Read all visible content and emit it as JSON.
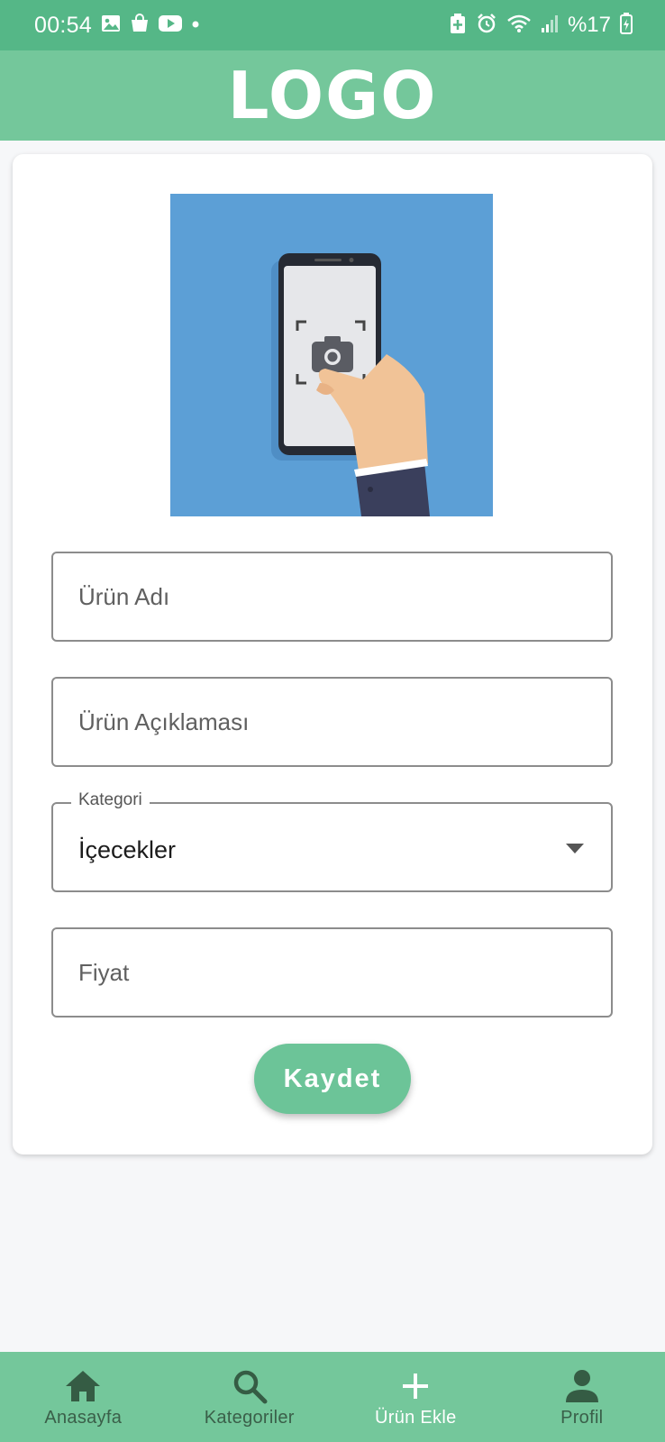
{
  "status_bar": {
    "time": "00:54",
    "battery": "%17",
    "icons": [
      "gallery-icon",
      "shopping-bag-icon",
      "youtube-icon",
      "dot-icon",
      "battery-saver-icon",
      "alarm-icon",
      "wifi-icon",
      "signal-icon",
      "battery-icon"
    ]
  },
  "header": {
    "logo": "LOGO"
  },
  "form": {
    "image_icon": "phone-camera-illustration",
    "name_placeholder": "Ürün Adı",
    "description_placeholder": "Ürün Açıklaması",
    "category_label": "Kategori",
    "category_value": "İçecekler",
    "price_placeholder": "Fiyat",
    "save_label": "Kaydet"
  },
  "bottom_nav": {
    "items": [
      {
        "label": "Anasayfa",
        "icon": "home-icon"
      },
      {
        "label": "Kategoriler",
        "icon": "search-icon"
      },
      {
        "label": "Ürün Ekle",
        "icon": "plus-icon",
        "active": true
      },
      {
        "label": "Profil",
        "icon": "person-icon"
      }
    ]
  },
  "colors": {
    "status_bar": "#55b787",
    "header": "#74c79b",
    "button": "#6cc498",
    "nav_label": "#3a5f49",
    "image_bg": "#5c9fd6"
  }
}
